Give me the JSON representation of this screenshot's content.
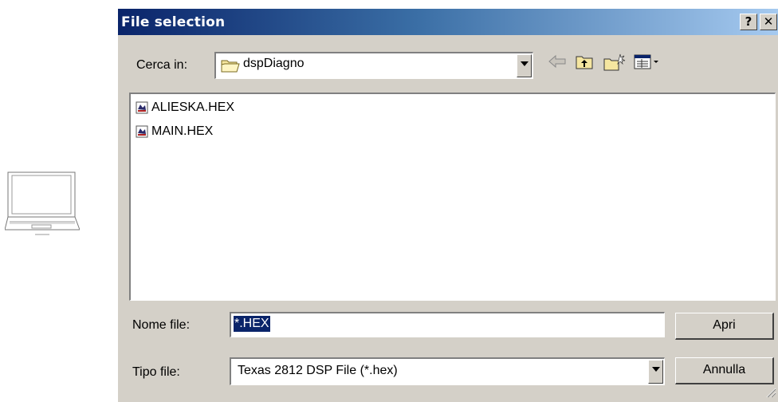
{
  "desktop": {
    "icon": "laptop-icon"
  },
  "dialog": {
    "title": "File selection",
    "help_label": "?",
    "close_label": "✕",
    "look_in": {
      "label": "Cerca in:",
      "folder": "dspDiagno",
      "folder_icon": "folder-icon"
    },
    "toolbar": {
      "back_icon": "back-arrow-icon",
      "up_icon": "up-folder-icon",
      "new_folder_icon": "new-folder-icon",
      "view_icon": "view-menu-icon"
    },
    "files": [
      {
        "name": "ALIESKA.HEX",
        "icon": "hex-file-icon"
      },
      {
        "name": "MAIN.HEX",
        "icon": "hex-file-icon"
      }
    ],
    "filename": {
      "label": "Nome file:",
      "value": "*.HEX"
    },
    "filetype": {
      "label": "Tipo file:",
      "value": "Texas 2812 DSP File (*.hex)"
    },
    "buttons": {
      "open": "Apri",
      "cancel": "Annulla"
    }
  }
}
